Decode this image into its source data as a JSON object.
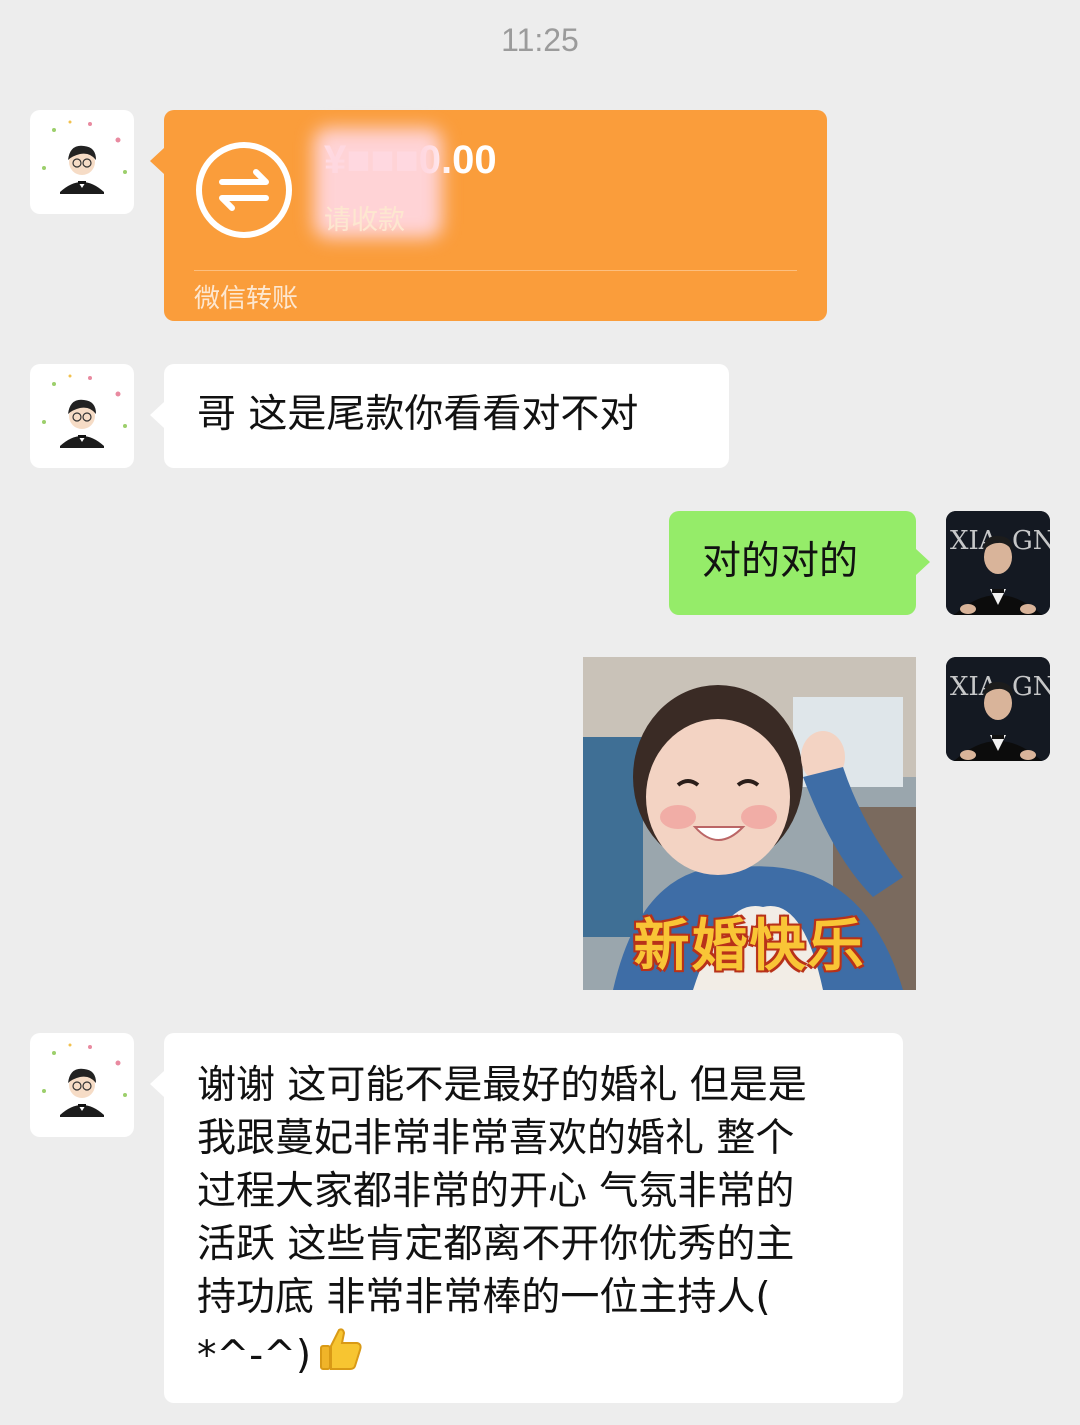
{
  "timestamp": "11:25",
  "messages": {
    "transfer": {
      "amount": "¥■■■0.00",
      "amount_visible": ".00",
      "status": "请收款",
      "footer": "微信转账",
      "color": "#fa9d3b"
    },
    "friend_1": {
      "text": "哥 这是尾款你看看对不对"
    },
    "me_1": {
      "text": "对的对的"
    },
    "sticker": {
      "caption": "新婚快乐"
    },
    "friend_2": {
      "text": "谢谢 这可能不是最好的婚礼 但是是\n我跟蔓妃非常非常喜欢的婚礼 整个\n过程大家都非常的开心 气氛非常的\n活跃 这些肯定都离不开你优秀的主\n持功底 非常非常棒的一位主持人(\n*^-^)"
    }
  },
  "colors": {
    "background": "#ededed",
    "me_bubble": "#95ec69",
    "friend_bubble": "#ffffff",
    "transfer": "#fa9d3b"
  },
  "icons": {
    "transfer": "transfer-arrows-icon",
    "emoji": "thumbs-up-emoji"
  }
}
